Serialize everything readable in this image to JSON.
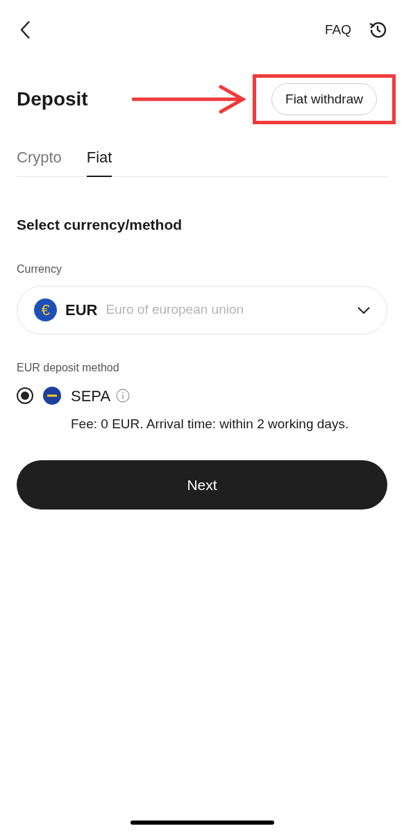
{
  "header": {
    "faq": "FAQ"
  },
  "title": "Deposit",
  "action_button": {
    "label": "Fiat withdraw",
    "highlighted": true
  },
  "tabs": [
    {
      "label": "Crypto",
      "selected": false
    },
    {
      "label": "Fiat",
      "selected": true
    }
  ],
  "section_title": "Select currency/method",
  "currency": {
    "label": "Currency",
    "symbol": "€",
    "code": "EUR",
    "name": "Euro of european union"
  },
  "method": {
    "label": "EUR deposit method",
    "options": [
      {
        "name": "SEPA",
        "selected": true,
        "fee": "Fee: 0 EUR. Arrival time: within 2 working days."
      }
    ]
  },
  "next_button": "Next"
}
